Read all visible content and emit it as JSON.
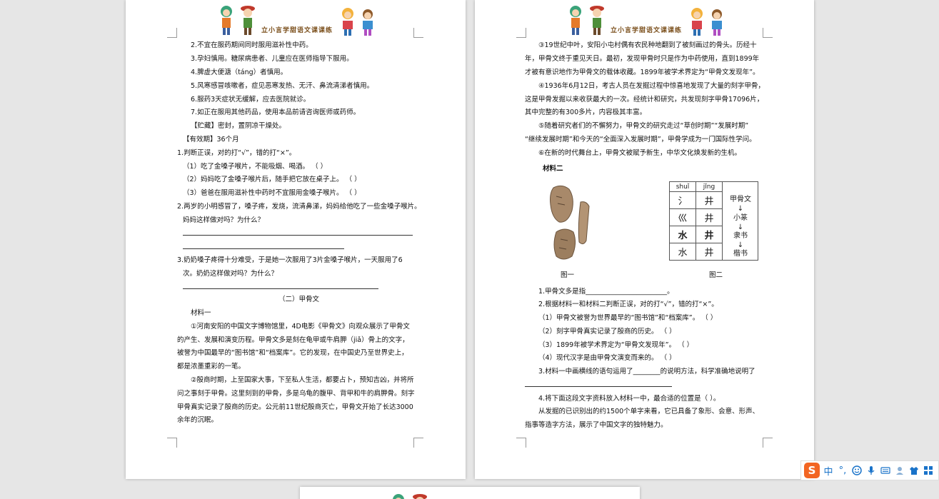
{
  "header": {
    "title": "立小言学甜语文课课练"
  },
  "left_page": {
    "lines": [
      "2.不宜在服药期间同时服用滋补性中药。",
      "3.孕妇慎用。糖尿病患者、儿童应在医师指导下服用。",
      "4.脾虚大便溏（táng）者慎用。",
      "5.风寒感冒咳嗽者，症见恶寒发热、无汗、鼻流清涕者慎用。",
      "6.服药3天症状无缓解，应去医院就诊。",
      "7.如正在服用其他药品，使用本品前请咨询医师或药师。",
      "【贮藏】密封，置阴凉干燥处。",
      "【有效期】36个月",
      "1.判断正误，对的打“√”，错的打“×”。",
      "（1）吃了金嗓子喉片，不能吸烟、喝酒。                （    ）",
      "（2）妈妈吃了金嗓子喉片后，随手把它放在桌子上。      （    ）",
      "（3）爸爸在服用滋补性中药时不宜服用金嗓子喉片。      （    ）",
      "2.两岁的小明感冒了，嗓子疼，发烧，流清鼻涕，妈妈给他吃了一些金嗓子喉片。",
      "妈妈这样做对吗？为什么？",
      "3.奶奶嗓子疼得十分难受，于是她一次服用了3片金嗓子喉片，一天服用了6",
      "次。奶奶这样做对吗？为什么？",
      "（二）甲骨文",
      "材料一",
      "①河南安阳的中国文字博物馆里，4D电影《甲骨文》向观众展示了甲骨文",
      "的产生、发展和演变历程。甲骨文多是刻在龟甲或牛肩胛（jiǎ）骨上的文字，",
      "被誉为中国最早的“图书馆”和“档案库”。它的发现，在中国史乃至世界史上，",
      "都是浓墨重彩的一笔。",
      "②殷商时期，上至国家大事，下至私人生活，都要占卜，预知吉凶，并将所",
      "问之事刻于甲骨。这里刻到的甲骨，多是乌龟的腹甲、背甲和牛的肩胛骨。刻字",
      "甲骨真实记录了殷商的历史。公元前11世纪殷商灭亡，甲骨文开始了长达3000",
      "余年的沉眠。"
    ]
  },
  "right_page": {
    "lines": [
      "③19世纪中叶，安阳小屯村偶有农民种地翻到了被刻画过的骨头。历经十",
      "年，甲骨文终于重见天日。最初，发现甲骨时只是作为中药使用，直到1899年",
      "才被有意识地作为甲骨文的载体收藏。1899年被学术界定为“甲骨文发现年”。",
      "④1936年6月12日，考古人员在发掘过程中惊喜地发现了大量的刻字甲骨，",
      "这是甲骨发掘以来收获最大的一次。经统计和研究，共发现刻字甲骨17096片，",
      "其中完整的有300多片，内容极其丰富。",
      "⑤随着研究者们的不懈努力，甲骨文的研究走过“草创时期”“发展时期”",
      "“继续发展时期”和今天的“全面深入发展时期”，甲骨学成为一门国际性学问。",
      "⑥在新的时代舞台上，甲骨文被赋予新生，中华文化焕发新的生机。",
      "材料二",
      "1.甲骨文多是指________________________。",
      "2.根据材料一和材料二判断正误，对的打“√”，错的打“×”。",
      "（1）甲骨文被誉为世界最早的“图书馆”和“档案库”。   （    ）",
      "（2）刻字甲骨真实记录了殷商的历史。                  （    ）",
      "（3）1899年被学术界定为“甲骨文发现年”。              （    ）",
      "（4）现代汉字是由甲骨文演变而来的。                  （    ）",
      "3.材料一中画横线的语句运用了________的说明方法，科学准确地说明了",
      "4.将下面这段文字资料放入材料一中，最合适的位置是（    ）。",
      "从发掘的已识别出的约1500个单字来看，它已具备了象形、会意、形声、",
      "指事等造字方法，展示了中国文字的独特魅力。"
    ],
    "figure1_caption": "图一",
    "figure2_caption": "图二",
    "table": {
      "pinyin": [
        "shuǐ",
        "jǐng"
      ],
      "rows": [
        [
          "氵",
          "井"
        ],
        [
          "巛",
          "井"
        ],
        [
          "水",
          "井"
        ],
        [
          "水",
          "井"
        ]
      ],
      "evolution": [
        "甲骨文",
        "↓",
        "小篆",
        "↓",
        "隶书",
        "↓",
        "楷书"
      ]
    }
  },
  "ime_bar": {
    "logo": "S",
    "mode": "中",
    "punct": "°,"
  }
}
